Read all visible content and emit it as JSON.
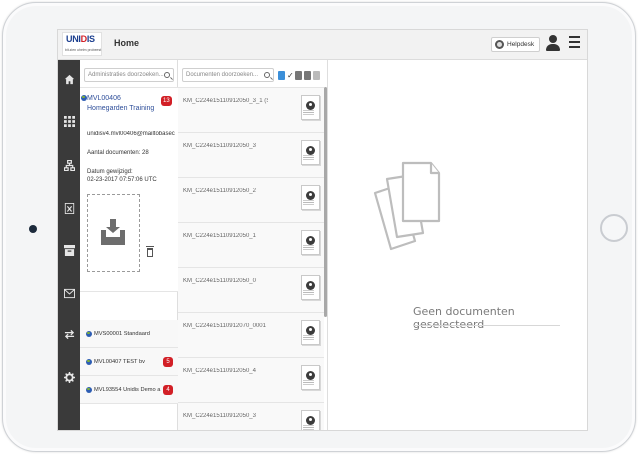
{
  "app": {
    "logo_mark": "UNIDIS",
    "logo_tagline": "bit.zien uhelm probeest",
    "page_title": "Home",
    "helpdesk_label": "Helpdesk"
  },
  "nav": {
    "icons": [
      "home-icon",
      "grid-icon",
      "network-icon",
      "excel-icon",
      "archive-icon",
      "mail-icon",
      "transfer-icon",
      "settings-icon"
    ]
  },
  "administrations": {
    "search_placeholder": "Administraties doorzoeken...",
    "selected": {
      "code": "MVL00406",
      "name": "Homegarden Training",
      "badge": "13",
      "email": "unidisv4.mvl00406@mailtobaseco...",
      "doc_count": "Aantal documenten: 28",
      "date_label": "Datum gewijzigd:",
      "date_value": "02-23-2017 07:57:06 UTC"
    },
    "others": [
      {
        "text": "MVS00001   Standaard",
        "badge": ""
      },
      {
        "text": "MVL00407   TEST bv",
        "badge": "5"
      },
      {
        "text": "MVL93554   Unidis Demo a",
        "badge": "4"
      }
    ]
  },
  "documents": {
    "search_placeholder": "Documenten doorzoeken...",
    "items": [
      "KM_C224e15110912050_3_1 (Sa...",
      "KM_C224e15110912050_3",
      "KM_C224e15110912050_2",
      "KM_C224e15110912050_1",
      "KM_C224e15110912050_0",
      "KM_C224e15110912070_0001",
      "KM_C224e15110912050_4",
      "KM_C224e15110912050_3"
    ]
  },
  "preview": {
    "empty_message": "Geen documenten geselecteerd"
  },
  "colors": {
    "accent_blue": "#2f4f9a",
    "badge_red": "#d21f26",
    "nav_bg": "#3a3a3a"
  }
}
